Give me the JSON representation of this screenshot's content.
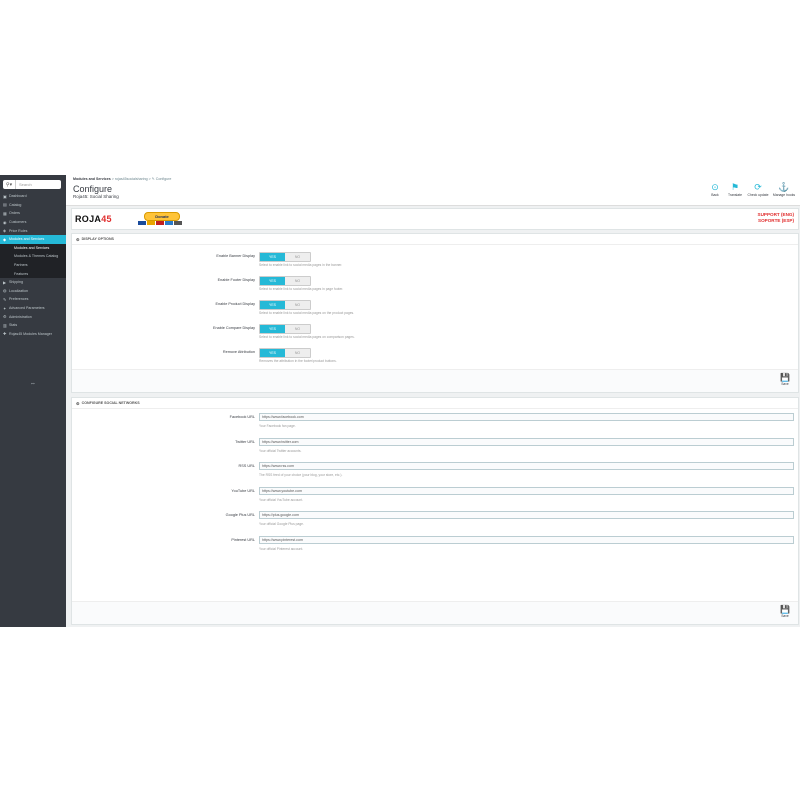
{
  "sidebar": {
    "search_placeholder": "Search",
    "items": [
      {
        "label": "Dashboard",
        "icon": "dashboard-icon",
        "glyph": "▣"
      },
      {
        "label": "Catalog",
        "icon": "catalog-icon",
        "glyph": "▤"
      },
      {
        "label": "Orders",
        "icon": "orders-icon",
        "glyph": "▦"
      },
      {
        "label": "Customers",
        "icon": "customers-icon",
        "glyph": "◉"
      },
      {
        "label": "Price Rules",
        "icon": "price-rules-icon",
        "glyph": "◈"
      },
      {
        "label": "Modules and Services",
        "icon": "modules-icon",
        "glyph": "◆"
      },
      {
        "label": "Modules and Services",
        "sub": true,
        "current": true
      },
      {
        "label": "Modules & Themes Catalog",
        "sub": true
      },
      {
        "label": "Partners",
        "sub": true
      },
      {
        "label": "Features",
        "sub": true
      },
      {
        "label": "Shipping",
        "icon": "shipping-icon",
        "glyph": "▶"
      },
      {
        "label": "Localization",
        "icon": "localization-icon",
        "glyph": "◍"
      },
      {
        "label": "Preferences",
        "icon": "preferences-icon",
        "glyph": "✎"
      },
      {
        "label": "Advanced Parameters",
        "icon": "advanced-icon",
        "glyph": "✦"
      },
      {
        "label": "Administration",
        "icon": "administration-icon",
        "glyph": "⚙"
      },
      {
        "label": "Stats",
        "icon": "stats-icon",
        "glyph": "▥"
      },
      {
        "label": "Rojas45 Modules Manager",
        "icon": "manager-icon",
        "glyph": "✚"
      }
    ]
  },
  "header": {
    "breadcrumb": {
      "root": "Modules and Services",
      "mid": "rojas45socialsharing",
      "leaf": "Configure"
    },
    "title": "Configure",
    "subtitle": "Roja45: Social Sharing",
    "toolbar": [
      {
        "label": "Back",
        "icon": "back-icon",
        "glyph": "⊙"
      },
      {
        "label": "Translate",
        "icon": "flag-icon",
        "glyph": "⚑"
      },
      {
        "label": "Check update",
        "icon": "refresh-icon",
        "glyph": "⟳"
      },
      {
        "label": "Manage hooks",
        "icon": "anchor-icon",
        "glyph": "⚓"
      }
    ]
  },
  "banner": {
    "logo_text": "ROJA",
    "logo_num": "45",
    "donate_label": "Donate",
    "support_en": "SUPPORT (ENG)",
    "support_es": "SOPORTE (ESP)"
  },
  "display_panel": {
    "heading": "DISPLAY OPTIONS",
    "rows": [
      {
        "label": "Enable Banner Display",
        "help": "Select to enable link to social media pages in the banner."
      },
      {
        "label": "Enable Footer Display",
        "help": "Select to enable link to social media pages in page footer."
      },
      {
        "label": "Enable Product Display",
        "help": "Select to enable link to social media pages on the product pages."
      },
      {
        "label": "Enable Compare Display",
        "help": "Select to enable link to social media pages on comparison pages."
      },
      {
        "label": "Remove Attribution",
        "help": "Removes the attribution in the footer/product buttons."
      }
    ],
    "on_label": "YES",
    "off_label": "NO",
    "save_label": "Save"
  },
  "networks_panel": {
    "heading": "CONFIGURE SOCIAL NETWORKS",
    "rows": [
      {
        "label": "Facebook URL",
        "value": "https://www.facebook.com",
        "help": "Your Facebook fan page."
      },
      {
        "label": "Twitter URL",
        "value": "https://www.twitter.com",
        "help": "Your official Twitter accounts."
      },
      {
        "label": "RSS URL",
        "value": "https://www.rss.com",
        "help": "The RSS feed of your choice (your blog, your store, etc.)."
      },
      {
        "label": "YouTube URL",
        "value": "https://www.youtube.com",
        "help": "Your official YouTube account."
      },
      {
        "label": "Google Plus URL",
        "value": "https://plus.google.com",
        "help": "Your official Google Plus page."
      },
      {
        "label": "Pinterest URL",
        "value": "https://www.pinterest.com",
        "help": "Your official Pinterest account."
      }
    ],
    "save_label": "Save"
  }
}
